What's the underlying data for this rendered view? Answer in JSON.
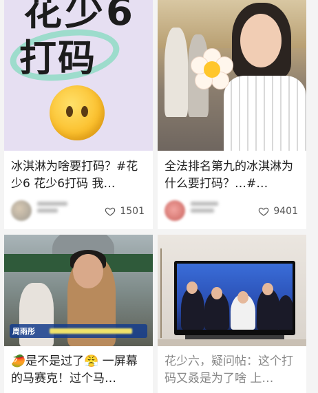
{
  "feed": {
    "cards": [
      {
        "thumb_text_line1": "花少6",
        "thumb_text_line2": "打码",
        "title": "冰淇淋为啥要打码？#花少6 花少6打码 我…",
        "likes": "1501"
      },
      {
        "title": "全法排名第九的冰淇淋为什么要打码？…#…",
        "likes": "9401"
      },
      {
        "thumb_caption": "周雨彤",
        "title": "🥭是不是过了😤 一屏幕的马赛克！过个马…"
      },
      {
        "title": "花少六，疑问帖：这个打码又叒是为了啥 上…"
      }
    ]
  },
  "icons": {
    "like": "heart-outline-icon",
    "emoji": "face-without-mouth-emoji"
  },
  "colors": {
    "page_bg": "#f4f4f4",
    "card_bg": "#ffffff",
    "title_text": "#222222",
    "muted_title": "#888888",
    "like_count": "#555555"
  }
}
